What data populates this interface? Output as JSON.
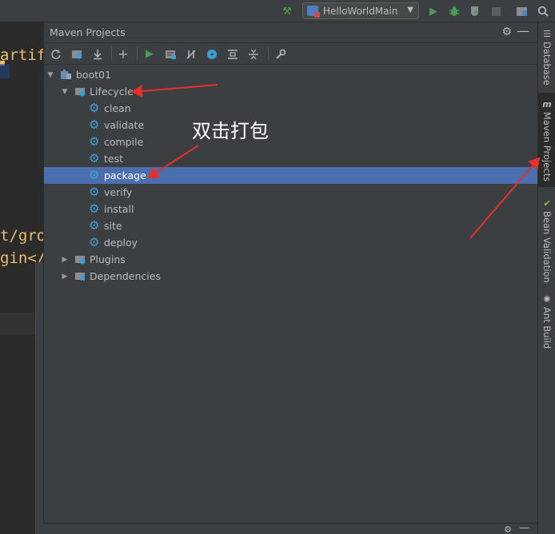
{
  "toolbar": {
    "run_config": "HelloWorldMain"
  },
  "editor": {
    "code_lines": [
      "artif",
      "t/gro",
      "gin</"
    ]
  },
  "panel": {
    "title": "Maven Projects"
  },
  "tree": {
    "root": "boot01",
    "lifecycle": "Lifecycle",
    "phases": [
      "clean",
      "validate",
      "compile",
      "test",
      "package",
      "verify",
      "install",
      "site",
      "deploy"
    ],
    "plugins": "Plugins",
    "dependencies": "Dependencies",
    "selected": "package"
  },
  "side_tabs": {
    "database": "Database",
    "maven": "Maven Projects",
    "bean": "Bean Validation",
    "ant": "Ant Build"
  },
  "annotation": {
    "text": "双击打包"
  },
  "colors": {
    "selection": "#4b6eaf",
    "gear": "#3d9fd8",
    "arrow": "#e8302b",
    "run": "#499c54"
  }
}
